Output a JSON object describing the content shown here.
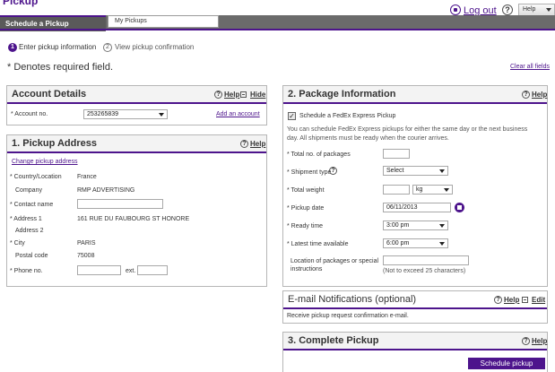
{
  "page": {
    "title": "Pickup"
  },
  "top_bar": {
    "logout_label": "Log out",
    "help_label": "Help",
    "help_icon": "?"
  },
  "tabs": [
    {
      "label": "Schedule a Pickup"
    },
    {
      "label": "My Pickups"
    }
  ],
  "steps": [
    {
      "number": "1",
      "label": "Enter pickup information"
    },
    {
      "number": "2",
      "label": "View pickup confirmation"
    }
  ],
  "required_note": "* Denotes required field.",
  "clear_all_label": "Clear all fields",
  "account_details": {
    "title": "Account Details",
    "help_label": "Help",
    "hide_label": "Hide",
    "account_no_label": "* Account no.",
    "account_no_value": "253265839",
    "add_account_label": "Add an account"
  },
  "pickup_address": {
    "title": "1. Pickup Address",
    "help_label": "Help",
    "change_link": "Change pickup address",
    "fields": [
      {
        "label": "* Country/Location",
        "value": "France"
      },
      {
        "label": "Company",
        "value": "RMP ADVERTISING"
      },
      {
        "label": "* Contact name",
        "value": ""
      },
      {
        "label": "* Address 1",
        "value": "161 RUE DU FAUBOURG ST HONORE"
      },
      {
        "label": "Address 2",
        "value": ""
      },
      {
        "label": "* City",
        "value": "PARIS"
      },
      {
        "label": "Postal code",
        "value": "75008"
      },
      {
        "label": "* Phone no.",
        "value": ""
      }
    ],
    "ext_label": "ext."
  },
  "package_info": {
    "title": "2. Package Information",
    "help_label": "Help",
    "checkbox_label": "Schedule a FedEx Express Pickup",
    "checkbox_checked": true,
    "info_line1": "You can schedule FedEx Express pickups for either the same day or the next business",
    "info_line2": "day. All shipments must be ready when the courier arrives.",
    "total_packages_label": "* Total no. of packages",
    "shipment_type_label": "* Shipment type",
    "shipment_type_value": "Select",
    "total_weight_label": "* Total weight",
    "weight_unit": "kg",
    "pickup_date_label": "* Pickup date",
    "pickup_date_value": "06/11/2013",
    "ready_time_label": "* Ready time",
    "ready_time_value": "3:00 pm",
    "latest_time_label": "* Latest time available",
    "latest_time_value": "6:00 pm",
    "location_label_1": "Location of packages or special",
    "location_label_2": "instructions",
    "location_note": "(Not to exceed 25 characters)"
  },
  "email_notifications": {
    "title": "E-mail Notifications (optional)",
    "help_label": "Help",
    "edit_label": "Edit",
    "body": "Receive pickup request confirmation e-mail."
  },
  "complete_pickup": {
    "title": "3. Complete Pickup",
    "help_label": "Help",
    "button_label": "Schedule pickup"
  },
  "colors": {
    "accent": "#4d148c",
    "tab_bar": "#6b6b6b"
  }
}
